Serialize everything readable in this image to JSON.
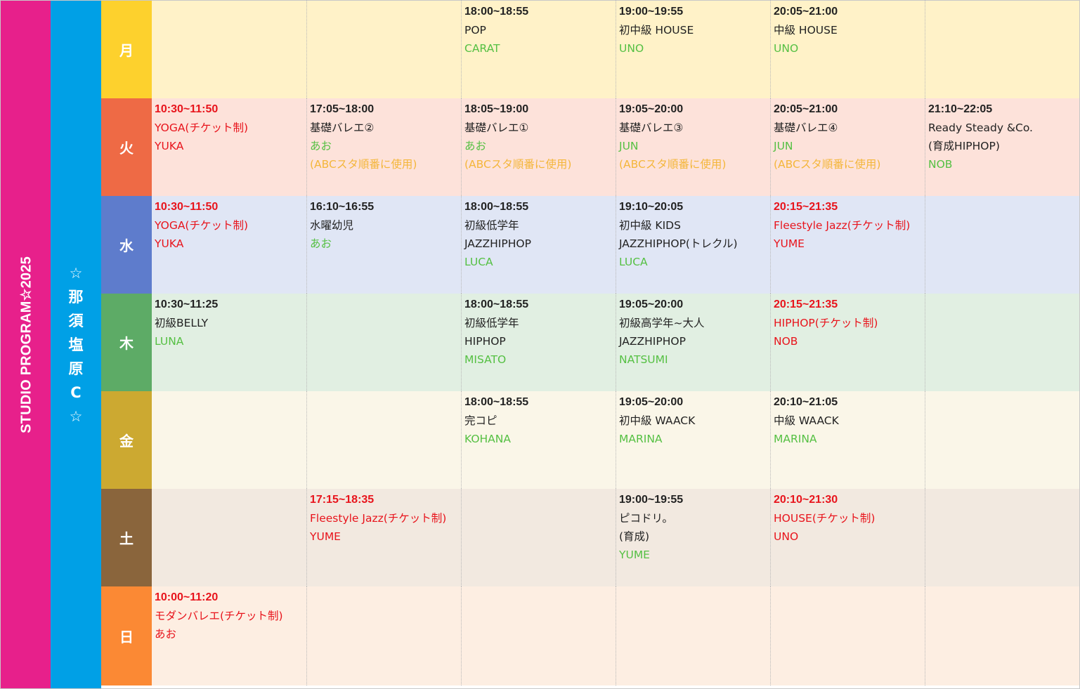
{
  "title": "STUDIO PROGRAM☆2025",
  "studio_chars": [
    "☆",
    "那",
    "須",
    "塩",
    "原",
    "C",
    "☆"
  ],
  "days": [
    {
      "label": "月",
      "color": "#fdd12d",
      "bg": "#fff2c8",
      "cells": [
        null,
        null,
        {
          "time": "18:00~18:55",
          "lines": [
            {
              "text": "POP"
            }
          ],
          "teacher": "CARAT"
        },
        {
          "time": "19:00~19:55",
          "lines": [
            {
              "text": "初中級 HOUSE"
            }
          ],
          "teacher": "UNO"
        },
        {
          "time": "20:05~21:00",
          "lines": [
            {
              "text": "中級 HOUSE"
            }
          ],
          "teacher": "UNO"
        },
        null
      ]
    },
    {
      "label": "火",
      "color": "#ee6a45",
      "bg": "#fde2da",
      "cells": [
        {
          "time": "10:30~11:50",
          "red": true,
          "lines": [
            {
              "text": "YOGA(チケット制)",
              "style": "red"
            }
          ],
          "teacher": "YUKA",
          "teacher_style": "red"
        },
        {
          "time": "17:05~18:00",
          "lines": [
            {
              "text": "基礎バレエ②"
            }
          ],
          "teacher": "あお",
          "note": "(ABCスタ順番に使用)"
        },
        {
          "time": "18:05~19:00",
          "lines": [
            {
              "text": "基礎バレエ①"
            }
          ],
          "teacher": "あお",
          "note": "(ABCスタ順番に使用)"
        },
        {
          "time": "19:05~20:00",
          "lines": [
            {
              "text": "基礎バレエ③"
            }
          ],
          "teacher": "JUN",
          "note": "(ABCスタ順番に使用)"
        },
        {
          "time": "20:05~21:00",
          "lines": [
            {
              "text": "基礎バレエ④"
            }
          ],
          "teacher": "JUN",
          "note": "(ABCスタ順番に使用)"
        },
        {
          "time": "21:10~22:05",
          "lines": [
            {
              "text": "Ready Steady &Co."
            },
            {
              "text": "(育成HIPHOP)"
            }
          ],
          "teacher": "NOB"
        }
      ]
    },
    {
      "label": "水",
      "color": "#5e7ccc",
      "bg": "#e0e6f5",
      "cells": [
        {
          "time": "10:30~11:50",
          "red": true,
          "lines": [
            {
              "text": "YOGA(チケット制)",
              "style": "red"
            }
          ],
          "teacher": "YUKA",
          "teacher_style": "red"
        },
        {
          "time": "16:10~16:55",
          "lines": [
            {
              "text": "水曜幼児"
            }
          ],
          "teacher": "あお"
        },
        {
          "time": "18:00~18:55",
          "lines": [
            {
              "text": "初級低学年"
            },
            {
              "text": "JAZZHIPHOP"
            }
          ],
          "teacher": "LUCA"
        },
        {
          "time": "19:10~20:05",
          "lines": [
            {
              "text": "初中級 KIDS"
            },
            {
              "text": "JAZZHIPHOP(トレクル)"
            }
          ],
          "teacher": "LUCA"
        },
        {
          "time": "20:15~21:35",
          "red": true,
          "lines": [
            {
              "text": "Fleestyle Jazz(チケット制)",
              "style": "red"
            }
          ],
          "teacher": "YUME",
          "teacher_style": "red"
        },
        null
      ]
    },
    {
      "label": "木",
      "color": "#5dab66",
      "bg": "#e1efe2",
      "cells": [
        {
          "time": "10:30~11:25",
          "lines": [
            {
              "text": "初級BELLY"
            }
          ],
          "teacher": "LUNA"
        },
        null,
        {
          "time": "18:00~18:55",
          "lines": [
            {
              "text": "初級低学年"
            },
            {
              "text": "HIPHOP"
            }
          ],
          "teacher": "MISATO"
        },
        {
          "time": "19:05~20:00",
          "lines": [
            {
              "text": "初級高学年~大人"
            },
            {
              "text": "JAZZHIPHOP"
            }
          ],
          "teacher": "NATSUMI"
        },
        {
          "time": "20:15~21:35",
          "red": true,
          "lines": [
            {
              "text": "HIPHOP(チケット制)",
              "style": "red"
            }
          ],
          "teacher": "NOB",
          "teacher_style": "red"
        },
        null
      ]
    },
    {
      "label": "金",
      "color": "#cca931",
      "bg": "#faf6e8",
      "cells": [
        null,
        null,
        {
          "time": "18:00~18:55",
          "lines": [
            {
              "text": "完コピ"
            }
          ],
          "teacher": "KOHANA"
        },
        {
          "time": "19:05~20:00",
          "lines": [
            {
              "text": "初中級 WAACK"
            }
          ],
          "teacher": "MARINA"
        },
        {
          "time": "20:10~21:05",
          "lines": [
            {
              "text": "中級 WAACK"
            }
          ],
          "teacher": "MARINA"
        },
        null
      ]
    },
    {
      "label": "土",
      "color": "#8a653c",
      "bg": "#f2e9e0",
      "cells": [
        null,
        {
          "time": "17:15~18:35",
          "red": true,
          "lines": [
            {
              "text": "Fleestyle Jazz(チケット制)",
              "style": "red"
            }
          ],
          "teacher": "YUME",
          "teacher_style": "red"
        },
        null,
        {
          "time": "19:00~19:55",
          "lines": [
            {
              "text": "ピコドリ。"
            },
            {
              "text": "(育成)"
            }
          ],
          "teacher": "YUME"
        },
        {
          "time": "20:10~21:30",
          "red": true,
          "lines": [
            {
              "text": "HOUSE(チケット制)",
              "style": "red"
            }
          ],
          "teacher": "UNO",
          "teacher_style": "red"
        },
        null
      ]
    },
    {
      "label": "日",
      "color": "#fb8934",
      "bg": "#fdeee2",
      "cells": [
        {
          "time": "10:00~11:20",
          "red": true,
          "lines": [
            {
              "text": "モダンバレエ(チケット制)",
              "style": "red"
            }
          ],
          "teacher": "あお",
          "teacher_style": "red"
        },
        null,
        null,
        null,
        null,
        null
      ]
    }
  ]
}
